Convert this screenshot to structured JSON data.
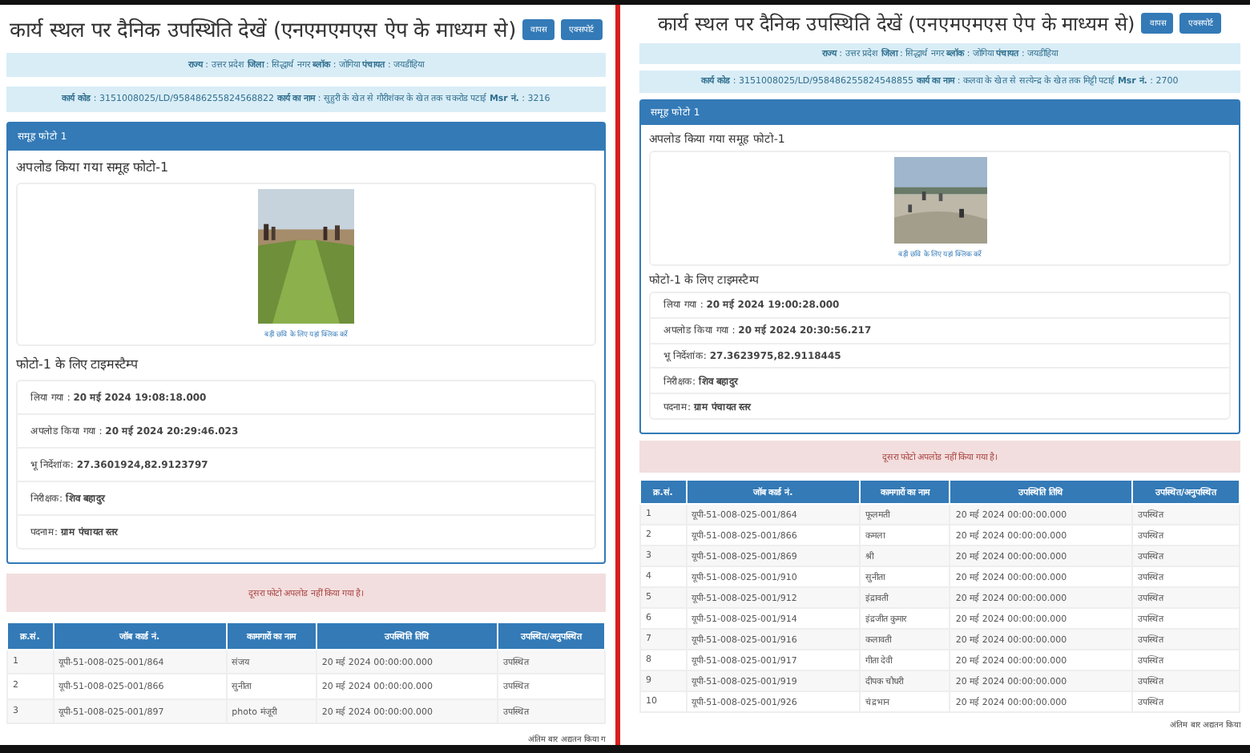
{
  "screens": [
    {
      "title": "कार्य स्थल पर दैनिक उपस्थिति देखें (एनएमएमएस ऐप के माध्यम से)",
      "buttons": [
        "वापस",
        "एक्सपोर्ट"
      ],
      "location": "**राज्य** : उत्तर प्रदेश **जिला** : सिद्धार्थ नगर **ब्लॉक** : जोगिया **पंचायत** : जयडीहिया",
      "work": "**कार्य कोड** : 3151008025/LD/958486255824568822 **कार्य का नाम** : सुहुरी के खेत से गौरीशंकर के खेत तक चकरोड पटाई **Msr नं.** : 3216",
      "panel_header": "समूह फोटो 1",
      "photo_title": "अपलोड किया गया समूह फोटो-1",
      "photo": {
        "kind": "picture"
      },
      "photo_link": "बड़ी छवि के लिए यहां क्लिक करें",
      "timestamp_title": "फोटो-1 के लिए टाइमस्टैम्प",
      "timestamps": [
        "लिया गया : **20 मई 2024 19:08:18.000**",
        "अपलोड किया गया : **20 मई 2024 20:29:46.023**",
        "भू निर्देशांक: **27.3601924,82.9123797**",
        "निरीक्षक: **शिव बहादुर**",
        "पदनाम: **ग्राम पंचायत स्तर**"
      ],
      "alert": "दूसरा फोटो अपलोड नहीं किया गया है।",
      "table": {
        "columns": [
          "क्र.सं.",
          "जॉब कार्ड नं.",
          "कामगारों का नाम",
          "उपस्थिति तिथि",
          "उपस्थित/अनुपस्थित"
        ],
        "rows": [
          [
            "1",
            "यूपी-51-008-025-001/864",
            "संजय",
            "20 मई 2024 00:00:00.000",
            "उपस्थित"
          ],
          [
            "2",
            "यूपी-51-008-025-001/866",
            "सुनीता",
            "20 मई 2024 00:00:00.000",
            "उपस्थित"
          ],
          [
            "3",
            "यूपी-51-008-025-001/897",
            "photo मंजूरी",
            "20 मई 2024 00:00:00.000",
            "उपस्थित"
          ]
        ]
      },
      "footer": "अंतिम बार अद्यतन किया ग"
    },
    {
      "title": "कार्य स्थल पर दैनिक उपस्थिति देखें (एनएमएमएस ऐप के माध्यम से)",
      "buttons": [
        "वापस",
        "एक्सपोर्ट"
      ],
      "location": "**राज्य** : उत्तर प्रदेश **जिला** : सिद्धार्थ नगर **ब्लॉक** : जोगिया **पंचायत** : जयडीहिया",
      "work": "**कार्य कोड** : 3151008025/LD/958486255824548855 **कार्य का नाम** : कलवा के खेत से सत्येन्द्र के खेत तक मिट्टी पटाई **Msr नं.** : 2700",
      "panel_header": "समूह फोटो 1",
      "photo_title": "अपलोड किया गया समूह फोटो-1",
      "photo": {
        "kind": "picture"
      },
      "photo_link": "बड़ी छवि के लिए यहां क्लिक करें",
      "timestamp_title": "फोटो-1 के लिए टाइमस्टैम्प",
      "timestamps": [
        "लिया गया : **20 मई 2024 19:00:28.000**",
        "अपलोड किया गया : **20 मई 2024 20:30:56.217**",
        "भू निर्देशांक: **27.3623975,82.9118445**",
        "निरीक्षक: **शिव बहादुर**",
        "पदनाम: **ग्राम पंचायत स्तर**"
      ],
      "alert": "दूसरा फोटो अपलोड नहीं किया गया है।",
      "table": {
        "columns": [
          "क्र.सं.",
          "जॉब कार्ड नं.",
          "कामगारों का नाम",
          "उपस्थिति तिथि",
          "उपस्थित/अनुपस्थित"
        ],
        "rows": [
          [
            "1",
            "यूपी-51-008-025-001/864",
            "फूलमती",
            "20 मई 2024 00:00:00.000",
            "उपस्थित"
          ],
          [
            "2",
            "यूपी-51-008-025-001/866",
            "कमला",
            "20 मई 2024 00:00:00.000",
            "उपस्थित"
          ],
          [
            "3",
            "यूपी-51-008-025-001/869",
            "श्री",
            "20 मई 2024 00:00:00.000",
            "उपस्थित"
          ],
          [
            "4",
            "यूपी-51-008-025-001/910",
            "सुनीता",
            "20 मई 2024 00:00:00.000",
            "उपस्थित"
          ],
          [
            "5",
            "यूपी-51-008-025-001/912",
            "इंद्रावती",
            "20 मई 2024 00:00:00.000",
            "उपस्थित"
          ],
          [
            "6",
            "यूपी-51-008-025-001/914",
            "इंद्रजीत कुमार",
            "20 मई 2024 00:00:00.000",
            "उपस्थित"
          ],
          [
            "7",
            "यूपी-51-008-025-001/916",
            "कलावती",
            "20 मई 2024 00:00:00.000",
            "उपस्थित"
          ],
          [
            "8",
            "यूपी-51-008-025-001/917",
            "गीता देवी",
            "20 मई 2024 00:00:00.000",
            "उपस्थित"
          ],
          [
            "9",
            "यूपी-51-008-025-001/919",
            "दीपक चौधरी",
            "20 मई 2024 00:00:00.000",
            "उपस्थित"
          ],
          [
            "10",
            "यूपी-51-008-025-001/926",
            "चंद्रभान",
            "20 मई 2024 00:00:00.000",
            "उपस्थित"
          ]
        ]
      },
      "footer": "अंतिम बार अद्यतन किया"
    }
  ]
}
